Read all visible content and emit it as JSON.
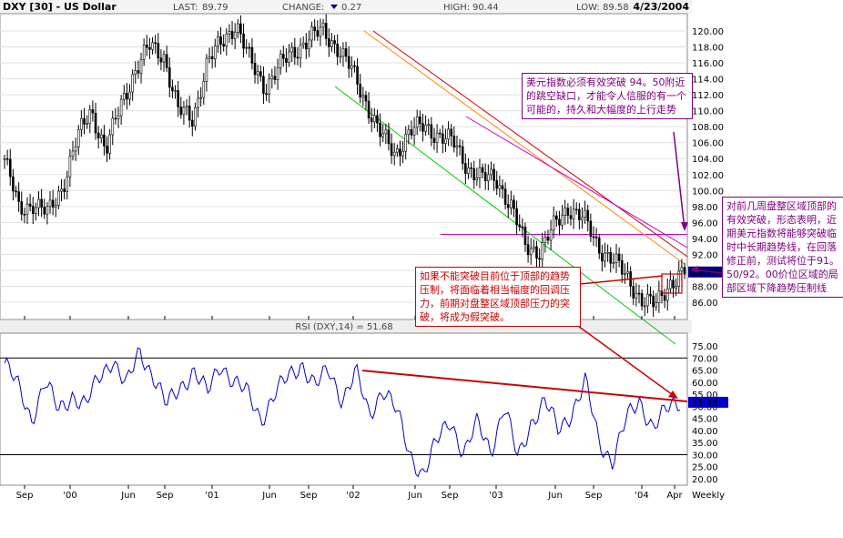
{
  "header": {
    "symbol": "DXY [30] - US Dollar",
    "last_label": "LAST:",
    "last_value": "89.79",
    "change_label": "CHANGE:",
    "change_value": "0.27",
    "high_label": "HIGH:",
    "high_value": "90.44",
    "low_label": "LOW:",
    "low_value": "89.58",
    "date": "4/23/2004"
  },
  "colors": {
    "price": "#000000",
    "rsi": "#0000cc",
    "green_channel": "#00cc00",
    "orange_trend": "#ff8800",
    "red_trend": "#cc0000",
    "magenta_trend": "#cc00cc",
    "last_tag": "#000080"
  },
  "chart_data": [
    {
      "type": "candlestick",
      "title": "DXY [30] - US Dollar",
      "ylim": [
        84,
        121
      ],
      "yticks": [
        "86.00",
        "88.00",
        "90.00",
        "92.00",
        "94.00",
        "96.00",
        "98.00",
        "100.00",
        "102.00",
        "104.00",
        "106.00",
        "108.00",
        "110.00",
        "112.00",
        "114.00",
        "116.00",
        "118.00",
        "120.00"
      ],
      "xticks": [
        "Sep",
        "'00",
        "Jun",
        "Sep",
        "'01",
        "Jun",
        "Sep",
        "'02",
        "Jun",
        "Sep",
        "'03",
        "Jun",
        "Sep",
        "'04",
        "Apr"
      ],
      "period": "Weekly",
      "last_tag": "89.79",
      "horizontal_level": 94.5,
      "price_points": [
        {
          "t": "Jul 99",
          "v": 104.0
        },
        {
          "t": "Sep 99",
          "v": 97.5
        },
        {
          "t": "Oct 99",
          "v": 98.5
        },
        {
          "t": "Nov 99",
          "v": 97.0
        },
        {
          "t": "Jan 00",
          "v": 100.5
        },
        {
          "t": "Mar 00",
          "v": 106.5
        },
        {
          "t": "May 00",
          "v": 110.0
        },
        {
          "t": "Jun 00",
          "v": 105.0
        },
        {
          "t": "Jul 00",
          "v": 110.5
        },
        {
          "t": "Sep 00",
          "v": 115.0
        },
        {
          "t": "Oct 00",
          "v": 118.0
        },
        {
          "t": "Nov 00",
          "v": 117.0
        },
        {
          "t": "Jan 01",
          "v": 110.0
        },
        {
          "t": "Feb 01",
          "v": 109.0
        },
        {
          "t": "Apr 01",
          "v": 116.0
        },
        {
          "t": "Jun 01",
          "v": 118.5
        },
        {
          "t": "Jul 01",
          "v": 121.0
        },
        {
          "t": "Aug 01",
          "v": 116.0
        },
        {
          "t": "Sep 01",
          "v": 113.0
        },
        {
          "t": "Oct 01",
          "v": 115.5
        },
        {
          "t": "Nov 01",
          "v": 117.5
        },
        {
          "t": "Jan 02",
          "v": 119.0
        },
        {
          "t": "Feb 02",
          "v": 120.0
        },
        {
          "t": "Mar 02",
          "v": 118.0
        },
        {
          "t": "Apr 02",
          "v": 115.0
        },
        {
          "t": "May 02",
          "v": 111.0
        },
        {
          "t": "Jun 02",
          "v": 107.0
        },
        {
          "t": "Jul 02",
          "v": 104.5
        },
        {
          "t": "Aug 02",
          "v": 107.5
        },
        {
          "t": "Sep 02",
          "v": 108.0
        },
        {
          "t": "Oct 02",
          "v": 107.0
        },
        {
          "t": "Nov 02",
          "v": 106.0
        },
        {
          "t": "Jan 03",
          "v": 103.0
        },
        {
          "t": "Feb 03",
          "v": 101.5
        },
        {
          "t": "Mar 03",
          "v": 101.5
        },
        {
          "t": "Apr 03",
          "v": 98.0
        },
        {
          "t": "May 03",
          "v": 93.0
        },
        {
          "t": "Jun 03",
          "v": 92.5
        },
        {
          "t": "Jul 03",
          "v": 95.5
        },
        {
          "t": "Aug 03",
          "v": 98.0
        },
        {
          "t": "Sep 03",
          "v": 96.5
        },
        {
          "t": "Oct 03",
          "v": 93.0
        },
        {
          "t": "Nov 03",
          "v": 91.5
        },
        {
          "t": "Dec 03",
          "v": 89.0
        },
        {
          "t": "Jan 04",
          "v": 86.5
        },
        {
          "t": "Feb 04",
          "v": 85.5
        },
        {
          "t": "Mar 04",
          "v": 88.5
        },
        {
          "t": "Apr 04",
          "v": 89.79
        }
      ]
    },
    {
      "type": "line",
      "title": "RSI (DXY,14) = 51.68",
      "ylim": [
        20,
        77
      ],
      "yticks": [
        "20.00",
        "25.00",
        "30.00",
        "35.00",
        "40.00",
        "45.00",
        "50.00",
        "55.00",
        "60.00",
        "65.00",
        "70.00",
        "75.00"
      ],
      "overbought": 70,
      "oversold": 30,
      "last_tag": "51.68",
      "series": [
        {
          "values": [
            68,
            58,
            45,
            60,
            48,
            55,
            50,
            62,
            70,
            58,
            73,
            63,
            50,
            58,
            65,
            55,
            68,
            60,
            55,
            45,
            55,
            62,
            68,
            58,
            65,
            53,
            64,
            46,
            58,
            48,
            30,
            22,
            35,
            45,
            30,
            43,
            32,
            50,
            28,
            44,
            52,
            40,
            48,
            60,
            35,
            28,
            44,
            52,
            42,
            48,
            52
          ]
        }
      ]
    }
  ],
  "annotations": {
    "top": "美元指数必须有效突破 94。50附近的跳空缺口，才能令人信服的有一个可能的，持久和大幅度的上行走势",
    "right": "对前几周盘整区域顶部的有效突破，形态表明，近期美元指数将能够突破临时中长期趋势线，在回落修正前，测试将位于91。50/92。00价位区域的局部区域下降趋势压制线",
    "mid": "如果不能突破目前位于顶部的趋势压制，将面临着相当幅度的回调压力，前期对盘整区域顶部压力的突破，将成为假突破。"
  }
}
